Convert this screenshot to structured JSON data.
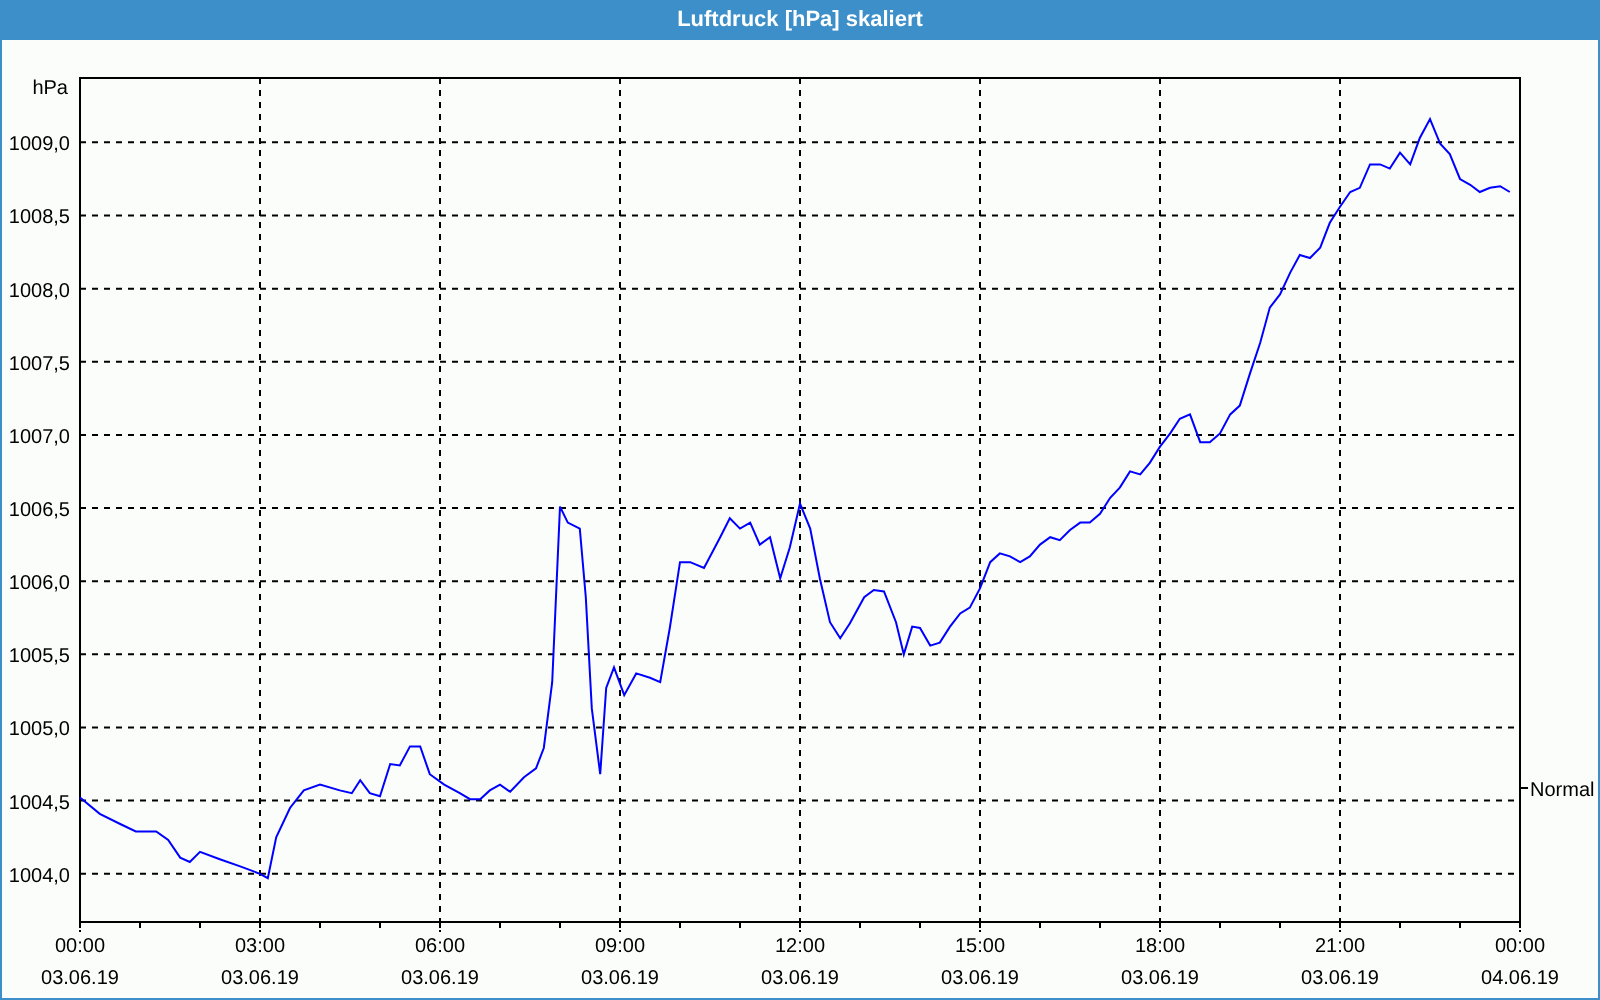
{
  "window": {
    "title": "Luftdruck [hPa] skaliert"
  },
  "chart": {
    "x_dates": [
      "03.06.19",
      "03.06.19",
      "03.06.19",
      "03.06.19",
      "03.06.19",
      "03.06.19",
      "03.06.19",
      "03.06.19",
      "04.06.19"
    ],
    "chart_data": {
      "type": "line",
      "ylabel": "hPa",
      "xlim": [
        0,
        24
      ],
      "ylim": [
        1003.67,
        1009.44
      ],
      "xticks": [
        {
          "value": 0,
          "label": "00:00"
        },
        {
          "value": 3,
          "label": "03:00"
        },
        {
          "value": 6,
          "label": "06:00"
        },
        {
          "value": 9,
          "label": "09:00"
        },
        {
          "value": 12,
          "label": "12:00"
        },
        {
          "value": 15,
          "label": "15:00"
        },
        {
          "value": 18,
          "label": "18:00"
        },
        {
          "value": 21,
          "label": "21:00"
        },
        {
          "value": 24,
          "label": "00:00"
        }
      ],
      "yticks": [
        {
          "value": 1004.0,
          "label": "1004,0"
        },
        {
          "value": 1004.5,
          "label": "1004,5"
        },
        {
          "value": 1005.0,
          "label": "1005,0"
        },
        {
          "value": 1005.5,
          "label": "1005,5"
        },
        {
          "value": 1006.0,
          "label": "1006,0"
        },
        {
          "value": 1006.5,
          "label": "1006,5"
        },
        {
          "value": 1007.0,
          "label": "1007,0"
        },
        {
          "value": 1007.5,
          "label": "1007,5"
        },
        {
          "value": 1008.0,
          "label": "1008,0"
        },
        {
          "value": 1008.5,
          "label": "1008,5"
        },
        {
          "value": 1009.0,
          "label": "1009,0"
        }
      ],
      "annotations": [
        "Normal"
      ],
      "grid": true,
      "x": [
        0,
        0.33,
        0.67,
        0.93,
        1.27,
        1.47,
        1.67,
        1.83,
        2,
        2.33,
        2.67,
        3,
        3.13,
        3.27,
        3.5,
        3.73,
        4,
        4.33,
        4.53,
        4.67,
        4.83,
        5,
        5.17,
        5.33,
        5.5,
        5.67,
        5.83,
        6.07,
        6.33,
        6.5,
        6.67,
        6.83,
        7,
        7.17,
        7.4,
        7.6,
        7.73,
        7.87,
        8,
        8.13,
        8.33,
        8.43,
        8.53,
        8.67,
        8.77,
        8.9,
        9.07,
        9.27,
        9.5,
        9.67,
        9.83,
        10,
        10.17,
        10.4,
        10.67,
        10.83,
        11,
        11.17,
        11.33,
        11.5,
        11.67,
        11.83,
        12,
        12.17,
        12.33,
        12.5,
        12.67,
        12.83,
        13.07,
        13.23,
        13.4,
        13.6,
        13.73,
        13.87,
        14,
        14.17,
        14.33,
        14.5,
        14.67,
        14.83,
        15,
        15.17,
        15.33,
        15.5,
        15.67,
        15.83,
        16,
        16.17,
        16.33,
        16.5,
        16.67,
        16.83,
        17,
        17.17,
        17.33,
        17.5,
        17.67,
        17.83,
        18,
        18.17,
        18.33,
        18.5,
        18.67,
        18.83,
        19,
        19.17,
        19.33,
        19.5,
        19.67,
        19.83,
        20,
        20.17,
        20.33,
        20.5,
        20.67,
        20.83,
        21,
        21.17,
        21.33,
        21.5,
        21.67,
        21.83,
        22,
        22.17,
        22.33,
        22.5,
        22.67,
        22.83,
        23,
        23.17,
        23.33,
        23.5,
        23.67,
        23.83
      ],
      "series": [
        {
          "color": "#0000ff",
          "values": [
            1004.52,
            1004.41,
            1004.34,
            1004.29,
            1004.29,
            1004.23,
            1004.11,
            1004.08,
            1004.15,
            1004.1,
            1004.05,
            1004.0,
            1003.97,
            1004.25,
            1004.45,
            1004.57,
            1004.61,
            1004.57,
            1004.55,
            1004.64,
            1004.55,
            1004.53,
            1004.75,
            1004.74,
            1004.87,
            1004.87,
            1004.68,
            1004.61,
            1004.55,
            1004.51,
            1004.51,
            1004.57,
            1004.61,
            1004.56,
            1004.66,
            1004.72,
            1004.86,
            1005.31,
            1006.51,
            1006.4,
            1006.36,
            1005.89,
            1005.13,
            1004.68,
            1005.27,
            1005.41,
            1005.22,
            1005.37,
            1005.34,
            1005.31,
            1005.68,
            1006.13,
            1006.13,
            1006.09,
            1006.3,
            1006.43,
            1006.36,
            1006.4,
            1006.25,
            1006.3,
            1006.02,
            1006.23,
            1006.53,
            1006.36,
            1006.02,
            1005.72,
            1005.61,
            1005.71,
            1005.89,
            1005.94,
            1005.93,
            1005.72,
            1005.5,
            1005.69,
            1005.68,
            1005.56,
            1005.58,
            1005.69,
            1005.78,
            1005.82,
            1005.95,
            1006.13,
            1006.19,
            1006.17,
            1006.13,
            1006.17,
            1006.25,
            1006.3,
            1006.28,
            1006.35,
            1006.4,
            1006.4,
            1006.46,
            1006.57,
            1006.64,
            1006.75,
            1006.73,
            1006.81,
            1006.92,
            1007.01,
            1007.11,
            1007.14,
            1006.95,
            1006.95,
            1007.01,
            1007.14,
            1007.2,
            1007.42,
            1007.63,
            1007.87,
            1007.96,
            1008.11,
            1008.23,
            1008.21,
            1008.28,
            1008.45,
            1008.56,
            1008.66,
            1008.69,
            1008.85,
            1008.85,
            1008.82,
            1008.93,
            1008.85,
            1009.03,
            1009.16,
            1008.99,
            1008.92,
            1008.75,
            1008.71,
            1008.66,
            1008.69,
            1008.7,
            1008.66
          ]
        }
      ]
    }
  }
}
